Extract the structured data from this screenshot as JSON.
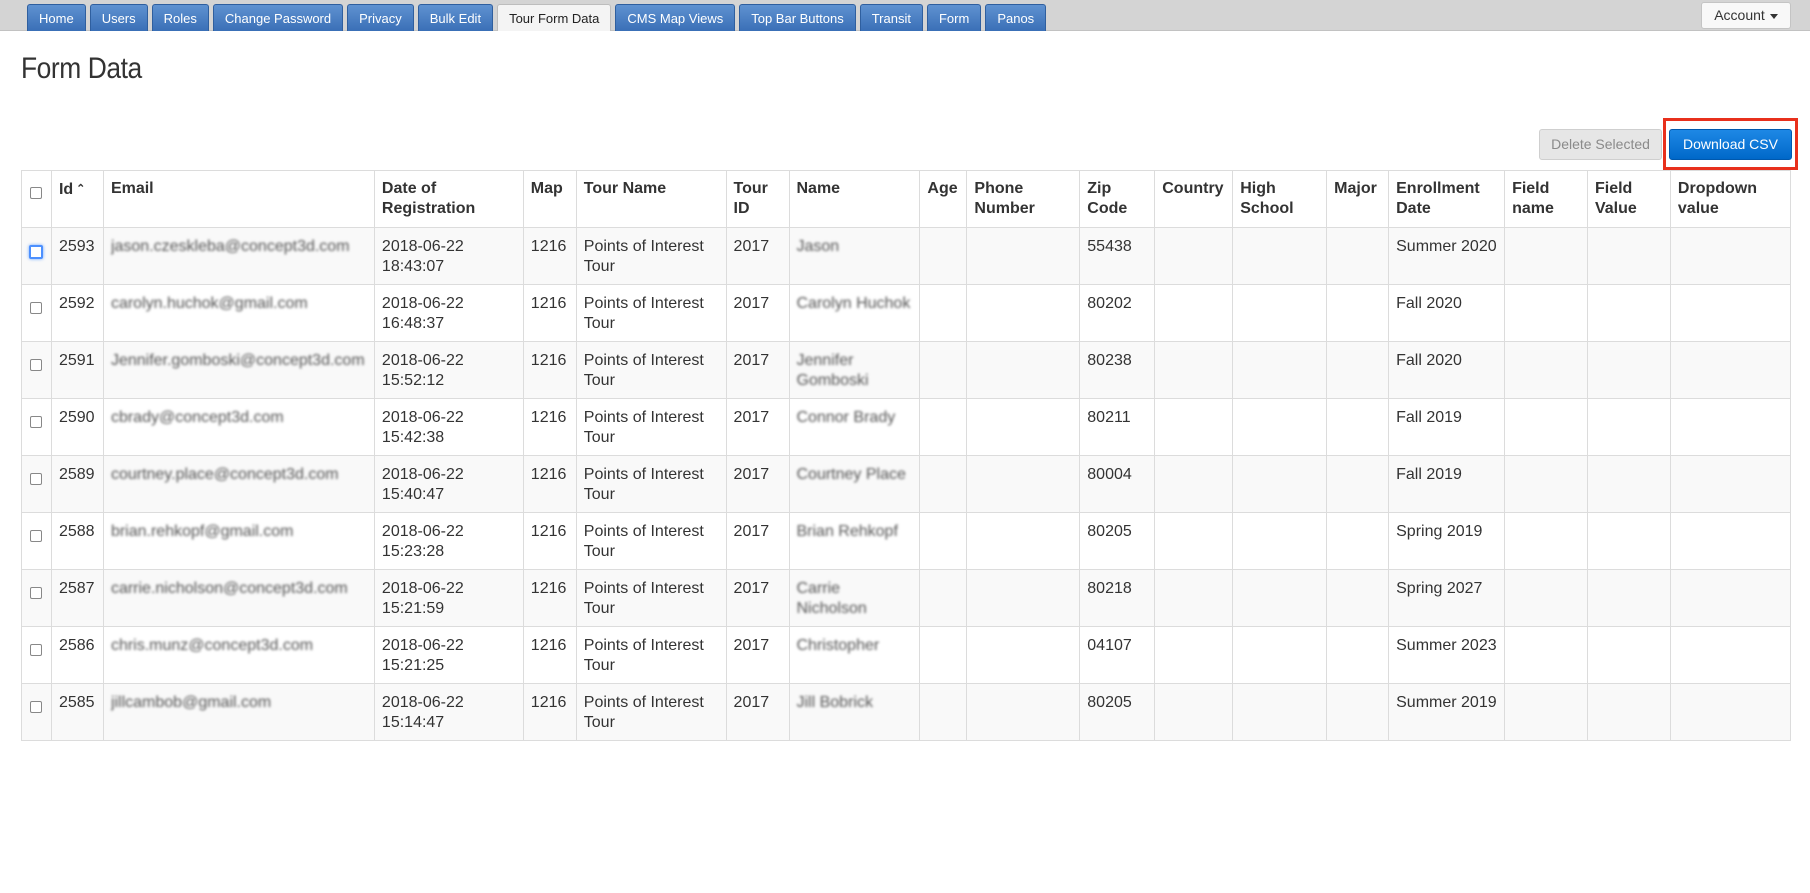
{
  "nav": {
    "tabs": [
      {
        "label": "Home",
        "active": false
      },
      {
        "label": "Users",
        "active": false
      },
      {
        "label": "Roles",
        "active": false
      },
      {
        "label": "Change Password",
        "active": false
      },
      {
        "label": "Privacy",
        "active": false
      },
      {
        "label": "Bulk Edit",
        "active": false
      },
      {
        "label": "Tour Form Data",
        "active": true
      },
      {
        "label": "CMS Map Views",
        "active": false
      },
      {
        "label": "Top Bar Buttons",
        "active": false
      },
      {
        "label": "Transit",
        "active": false
      },
      {
        "label": "Form",
        "active": false
      },
      {
        "label": "Panos",
        "active": false
      }
    ],
    "account_label": "Account"
  },
  "page": {
    "title": "Form Data",
    "delete_label": "Delete Selected",
    "download_label": "Download CSV"
  },
  "colors": {
    "tab_blue": "#3a6fb7",
    "download_blue": "#0068c9",
    "annotation_red": "#e8301c"
  },
  "table": {
    "columns": [
      "Id",
      "Email",
      "Date of Registration",
      "Map",
      "Tour Name",
      "Tour ID",
      "Name",
      "Age",
      "Phone Number",
      "Zip Code",
      "Country",
      "High School",
      "Major",
      "Enrollment Date",
      "Field name",
      "Field Value",
      "Dropdown value"
    ],
    "sort_icon": "chevron-up-icon",
    "rows": [
      {
        "id": "2593",
        "email": "jason.czeskleba@concept3d.com",
        "date": "2018-06-22",
        "time": "18:43:07",
        "map": "1216",
        "tour_name": "Points of Interest Tour",
        "tour_id": "2017",
        "name": "Jason",
        "age": "",
        "phone": "",
        "zip": "55438",
        "country": "",
        "high_school": "",
        "major": "",
        "enrollment": "Summer 2020",
        "field_name": "",
        "field_value": "",
        "dropdown": ""
      },
      {
        "id": "2592",
        "email": "carolyn.huchok@gmail.com",
        "date": "2018-06-22",
        "time": "16:48:37",
        "map": "1216",
        "tour_name": "Points of Interest Tour",
        "tour_id": "2017",
        "name": "Carolyn Huchok",
        "age": "",
        "phone": "",
        "zip": "80202",
        "country": "",
        "high_school": "",
        "major": "",
        "enrollment": "Fall 2020",
        "field_name": "",
        "field_value": "",
        "dropdown": ""
      },
      {
        "id": "2591",
        "email": "Jennifer.gomboski@concept3d.com",
        "date": "2018-06-22",
        "time": "15:52:12",
        "map": "1216",
        "tour_name": "Points of Interest Tour",
        "tour_id": "2017",
        "name": "Jennifer Gomboski",
        "age": "",
        "phone": "",
        "zip": "80238",
        "country": "",
        "high_school": "",
        "major": "",
        "enrollment": "Fall 2020",
        "field_name": "",
        "field_value": "",
        "dropdown": ""
      },
      {
        "id": "2590",
        "email": "cbrady@concept3d.com",
        "date": "2018-06-22",
        "time": "15:42:38",
        "map": "1216",
        "tour_name": "Points of Interest Tour",
        "tour_id": "2017",
        "name": "Connor Brady",
        "age": "",
        "phone": "",
        "zip": "80211",
        "country": "",
        "high_school": "",
        "major": "",
        "enrollment": "Fall 2019",
        "field_name": "",
        "field_value": "",
        "dropdown": ""
      },
      {
        "id": "2589",
        "email": "courtney.place@concept3d.com",
        "date": "2018-06-22",
        "time": "15:40:47",
        "map": "1216",
        "tour_name": "Points of Interest Tour",
        "tour_id": "2017",
        "name": "Courtney Place",
        "age": "",
        "phone": "",
        "zip": "80004",
        "country": "",
        "high_school": "",
        "major": "",
        "enrollment": "Fall 2019",
        "field_name": "",
        "field_value": "",
        "dropdown": ""
      },
      {
        "id": "2588",
        "email": "brian.rehkopf@gmail.com",
        "date": "2018-06-22",
        "time": "15:23:28",
        "map": "1216",
        "tour_name": "Points of Interest Tour",
        "tour_id": "2017",
        "name": "Brian Rehkopf",
        "age": "",
        "phone": "",
        "zip": "80205",
        "country": "",
        "high_school": "",
        "major": "",
        "enrollment": "Spring 2019",
        "field_name": "",
        "field_value": "",
        "dropdown": ""
      },
      {
        "id": "2587",
        "email": "carrie.nicholson@concept3d.com",
        "date": "2018-06-22",
        "time": "15:21:59",
        "map": "1216",
        "tour_name": "Points of Interest Tour",
        "tour_id": "2017",
        "name": "Carrie Nicholson",
        "age": "",
        "phone": "",
        "zip": "80218",
        "country": "",
        "high_school": "",
        "major": "",
        "enrollment": "Spring 2027",
        "field_name": "",
        "field_value": "",
        "dropdown": ""
      },
      {
        "id": "2586",
        "email": "chris.munz@concept3d.com",
        "date": "2018-06-22",
        "time": "15:21:25",
        "map": "1216",
        "tour_name": "Points of Interest Tour",
        "tour_id": "2017",
        "name": "Christopher",
        "age": "",
        "phone": "",
        "zip": "04107",
        "country": "",
        "high_school": "",
        "major": "",
        "enrollment": "Summer 2023",
        "field_name": "",
        "field_value": "",
        "dropdown": ""
      },
      {
        "id": "2585",
        "email": "jillcambob@gmail.com",
        "date": "2018-06-22",
        "time": "15:14:47",
        "map": "1216",
        "tour_name": "Points of Interest Tour",
        "tour_id": "2017",
        "name": "Jill Bobrick",
        "age": "",
        "phone": "",
        "zip": "80205",
        "country": "",
        "high_school": "",
        "major": "",
        "enrollment": "Summer 2019",
        "field_name": "",
        "field_value": "",
        "dropdown": ""
      }
    ]
  }
}
